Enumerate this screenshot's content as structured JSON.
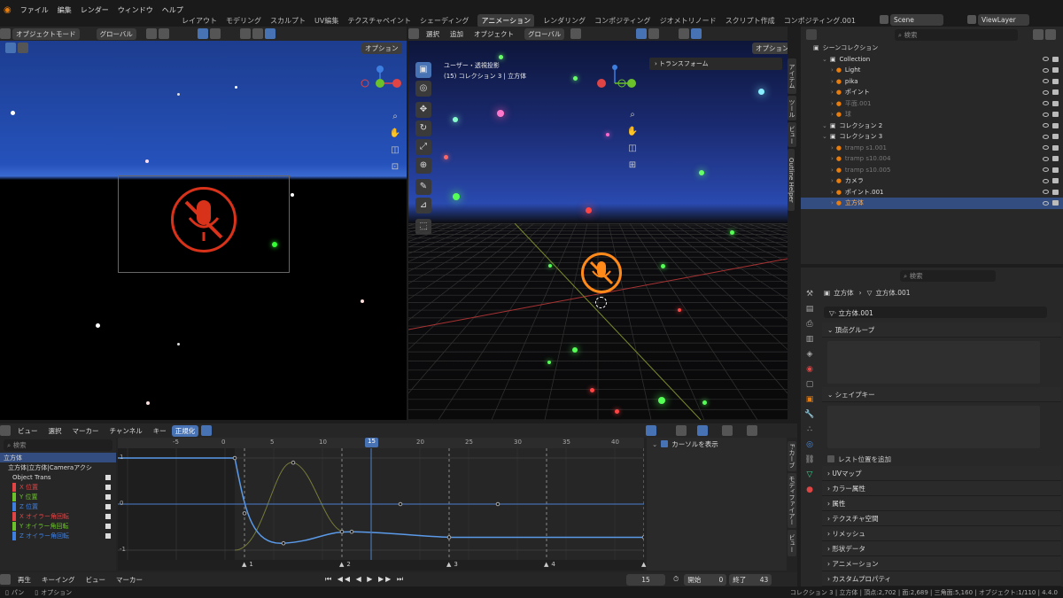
{
  "topbar": {
    "menus": [
      "ファイル",
      "編集",
      "レンダー",
      "ウィンドウ",
      "ヘルプ"
    ],
    "workspaces": [
      "レイアウト",
      "モデリング",
      "スカルプト",
      "UV編集",
      "テクスチャペイント",
      "シェーディング",
      "アニメーション",
      "レンダリング",
      "コンポジティング",
      "ジオメトリノード",
      "スクリプト作成",
      "コンポジティング.001"
    ],
    "active_workspace": "アニメーション",
    "scene": "Scene",
    "view_layer": "ViewLayer"
  },
  "left_view": {
    "mode": "オブジェクトモード",
    "orient": "グローバル",
    "options": "オプション"
  },
  "right_view": {
    "menus": [
      "選択",
      "追加",
      "オブジェクト"
    ],
    "orient": "グローバル",
    "options": "オプション",
    "info1": "ユーザー・透視投影",
    "info2": "(15) コレクション 3 | 立方体",
    "transform": "トランスフォーム",
    "tabs": [
      "アイテム",
      "ツール",
      "ビュー",
      "Outline Helper"
    ]
  },
  "outliner": {
    "search": "検索",
    "root": "シーンコレクション",
    "rows": [
      {
        "label": "Collection",
        "indent": 1,
        "color": "#ddd"
      },
      {
        "label": "Light",
        "indent": 2,
        "color": "#ddd"
      },
      {
        "label": "pika",
        "indent": 2,
        "color": "#ddd"
      },
      {
        "label": "ポイント",
        "indent": 2,
        "color": "#ddd"
      },
      {
        "label": "平面.001",
        "indent": 2,
        "color": "#777"
      },
      {
        "label": "球",
        "indent": 2,
        "color": "#777"
      },
      {
        "label": "コレクション 2",
        "indent": 1,
        "color": "#ddd"
      },
      {
        "label": "コレクション 3",
        "indent": 1,
        "color": "#ddd"
      },
      {
        "label": "tramp s1.001",
        "indent": 2,
        "color": "#777"
      },
      {
        "label": "tramp s10.004",
        "indent": 2,
        "color": "#777"
      },
      {
        "label": "tramp s10.005",
        "indent": 2,
        "color": "#777"
      },
      {
        "label": "カメラ",
        "indent": 2,
        "color": "#ddd"
      },
      {
        "label": "ポイント.001",
        "indent": 2,
        "color": "#ddd"
      },
      {
        "label": "立方体",
        "indent": 2,
        "color": "#ffb35a"
      }
    ]
  },
  "properties": {
    "search": "検索",
    "crumb_obj": "立方体",
    "crumb_data": "立方体.001",
    "mesh_name": "立方体.001",
    "vertex_groups": "頂点グループ",
    "shape_keys": "シェイプキー",
    "rest_pos": "レスト位置を追加",
    "sections": [
      "UVマップ",
      "カラー属性",
      "属性",
      "テクスチャ空間",
      "リメッシュ",
      "形状データ",
      "アニメーション",
      "カスタムプロパティ"
    ]
  },
  "graph": {
    "menus": [
      "ビュー",
      "選択",
      "マーカー",
      "チャンネル",
      "キー"
    ],
    "normalize": "正規化",
    "search": "検索",
    "show_cursor": "カーソルを表示",
    "channels": [
      {
        "label": "立方体",
        "color": "#4772b3"
      },
      {
        "label": "立方体|立方体|Cameraアクシ",
        "color": "#ddd"
      },
      {
        "label": "Object Trans",
        "color": "#ddd"
      },
      {
        "label": "X 位置",
        "color": "#e04444"
      },
      {
        "label": "Y 位置",
        "color": "#6bc12a"
      },
      {
        "label": "Z 位置",
        "color": "#3d7fe0"
      },
      {
        "label": "X オイラー角回転",
        "color": "#e04444"
      },
      {
        "label": "Y オイラー角回転",
        "color": "#6bc12a"
      },
      {
        "label": "Z オイラー角回転",
        "color": "#3d7fe0"
      }
    ],
    "frame_ticks": [
      "-5",
      "0",
      "5",
      "10",
      "15",
      "20",
      "25",
      "30",
      "35",
      "40"
    ],
    "current_frame": "15",
    "y_labels": [
      "1",
      "0",
      "-1"
    ],
    "markers": [
      "1",
      "2",
      "3",
      "4"
    ],
    "side_tabs": [
      "F-カーブ",
      "モディファイアー",
      "ビュー"
    ]
  },
  "timeline": {
    "menus": [
      "再生",
      "キーイング",
      "ビュー",
      "マーカー"
    ],
    "frame": "15",
    "start_label": "開始",
    "start": "0",
    "end_label": "終了",
    "end": "43"
  },
  "status": {
    "left1": "パン",
    "left2": "オプション",
    "right": "コレクション 3 | 立方体 | 頂点:2,702 | 面:2,689 | 三角面:5,160 | オブジェクト:1/110 | 4.4.0"
  }
}
